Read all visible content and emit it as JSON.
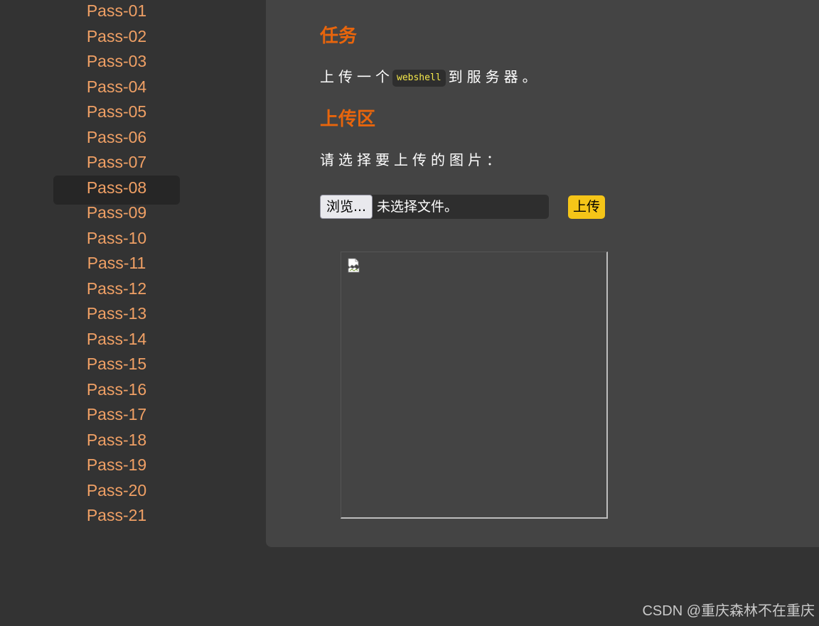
{
  "sidebar": {
    "items": [
      "Pass-01",
      "Pass-02",
      "Pass-03",
      "Pass-04",
      "Pass-05",
      "Pass-06",
      "Pass-07",
      "Pass-08",
      "Pass-09",
      "Pass-10",
      "Pass-11",
      "Pass-12",
      "Pass-13",
      "Pass-14",
      "Pass-15",
      "Pass-16",
      "Pass-17",
      "Pass-18",
      "Pass-19",
      "Pass-20",
      "Pass-21"
    ],
    "active_item": "Pass-08"
  },
  "task": {
    "heading": "任务",
    "text_before": "上传一个",
    "code": "webshell",
    "text_after": "到服务器。"
  },
  "upload_area": {
    "heading": "上传区",
    "prompt": "请选择要上传的图片：",
    "browse_label": "浏览...",
    "file_status": "未选择文件。",
    "upload_label": "上传"
  },
  "preview": {
    "icon": "broken-image-icon"
  },
  "watermark": "CSDN @重庆森林不在重庆",
  "colors": {
    "accent": "#e8650c",
    "nav_link": "#f0a065",
    "upload_button": "#f5c518",
    "code_text": "#f5e84a",
    "page_bg": "#333333",
    "panel_bg": "#444444"
  }
}
